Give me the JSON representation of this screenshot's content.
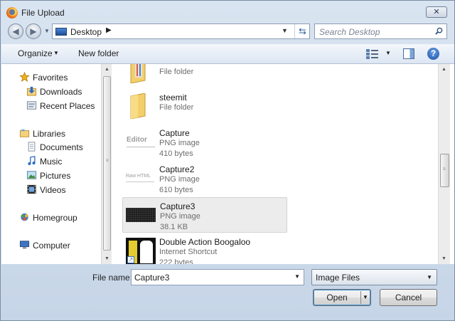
{
  "window": {
    "title": "File Upload",
    "close_label": "✕"
  },
  "address": {
    "location": "Desktop",
    "search_placeholder": "Search Desktop"
  },
  "toolbar": {
    "organize_label": "Organize",
    "new_folder_label": "New folder"
  },
  "nav": {
    "items": [
      {
        "label": "Favorites",
        "icon": "star-icon"
      },
      {
        "label": "Downloads",
        "icon": "downloads-icon"
      },
      {
        "label": "Recent Places",
        "icon": "recent-places-icon"
      },
      {
        "label": "Libraries",
        "icon": "libraries-icon"
      },
      {
        "label": "Documents",
        "icon": "documents-icon"
      },
      {
        "label": "Music",
        "icon": "music-icon"
      },
      {
        "label": "Pictures",
        "icon": "pictures-icon"
      },
      {
        "label": "Videos",
        "icon": "videos-icon"
      },
      {
        "label": "Homegroup",
        "icon": "homegroup-icon"
      },
      {
        "label": "Computer",
        "icon": "computer-icon"
      }
    ]
  },
  "files": [
    {
      "name": "",
      "type": "File folder",
      "size": ""
    },
    {
      "name": "steemit",
      "type": "File folder",
      "size": ""
    },
    {
      "name": "Capture",
      "type": "PNG image",
      "size": "410 bytes",
      "thumb_text": "Editor"
    },
    {
      "name": "Capture2",
      "type": "PNG image",
      "size": "610 bytes",
      "thumb_text": "Raw HTML"
    },
    {
      "name": "Capture3",
      "type": "PNG image",
      "size": "38.1 KB"
    },
    {
      "name": "Double Action Boogaloo",
      "type": "Internet Shortcut",
      "size": "222 bytes"
    }
  ],
  "bottom": {
    "file_name_label": "File name:",
    "file_name_value": "Capture3",
    "file_type_value": "Image Files",
    "open_label": "Open",
    "cancel_label": "Cancel"
  },
  "colors": {
    "selection": "#ececec",
    "accent": "#3b8fd6",
    "window": "#cfdcea"
  }
}
